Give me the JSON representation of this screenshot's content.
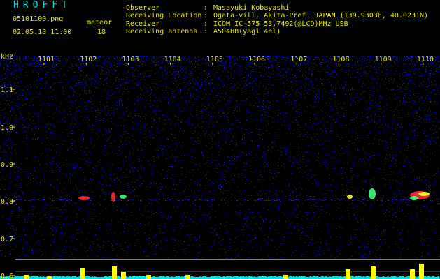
{
  "header": {
    "app_title": "HROFFT",
    "file_name": "05101100.png",
    "date_time": "02.05.10 11:00",
    "meteor_label": "meteor",
    "meteor_count": "18",
    "info": [
      {
        "key": "Observer",
        "value": "Masayuki Kobayashi"
      },
      {
        "key": "Receiving Location",
        "value": "Ogata-vill. Akita-Pref. JAPAN (139.9303E, 40.0231N)"
      },
      {
        "key": "Receiver",
        "value": "ICOM IC-575 53.7492(@LCD)MHz USB"
      },
      {
        "key": "Receiving antenna",
        "value": "A504HB(yagi 4el)"
      }
    ],
    "separator": ":"
  },
  "spectrogram": {
    "unit_label": "kHz",
    "y_ticks": [
      "1.1",
      "1.0",
      "0.9",
      "0.8",
      "0.7",
      "0.6"
    ],
    "y_tick_values": [
      1.1,
      1.0,
      0.9,
      0.8,
      0.7,
      0.6
    ],
    "y_range": [
      0.58,
      1.19
    ],
    "time_labels": [
      "1101",
      "1102",
      "1103",
      "1104",
      "1105",
      "1106",
      "1107",
      "1108",
      "1109",
      "1110"
    ],
    "echo_frequency_khz": 0.79,
    "colors": {
      "background": "#000000",
      "noise": "#1a1aff",
      "axis_text": "#e8e800",
      "trace_line": "#ffffff",
      "level_fill": "#ffff00",
      "level_baseline": "#00e0e0",
      "echo_hot": "#ff3030",
      "echo_warm": "#ffff40",
      "echo_cool": "#40ff80"
    }
  }
}
